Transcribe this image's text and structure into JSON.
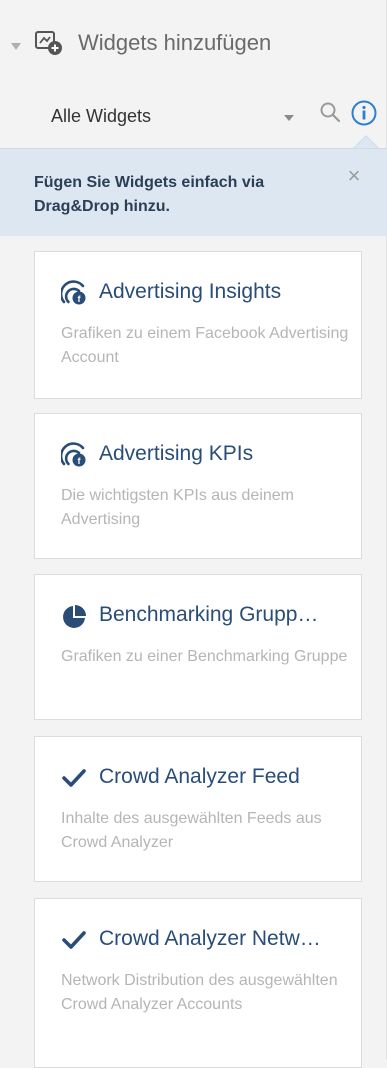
{
  "header": {
    "title": "Widgets hinzufügen",
    "icon": "add-widget-icon"
  },
  "filter": {
    "selected": "Alle Widgets",
    "search_icon": "search-icon",
    "info_icon": "info-icon"
  },
  "info_box": {
    "text": "Fügen Sie Widgets einfach via Drag&Drop hinzu.",
    "close_glyph": "×"
  },
  "widgets": [
    {
      "title": "Advertising Insights",
      "description": "Grafiken zu einem Facebook Advertising Account",
      "icon": "advertising-icon"
    },
    {
      "title": "Advertising KPIs",
      "description": "Die wichtigsten KPIs aus deinem Advertising",
      "icon": "advertising-icon"
    },
    {
      "title": "Benchmarking Grupp…",
      "description": "Grafiken zu einer Benchmarking Gruppe",
      "icon": "pie-chart-icon"
    },
    {
      "title": "Crowd Analyzer Feed",
      "description": "Inhalte des ausgewählten Feeds aus Crowd Analyzer",
      "icon": "checkmark-icon"
    },
    {
      "title": "Crowd Analyzer Netw…",
      "description": "Network Distribution des ausgewählten Crowd Analyzer Accounts",
      "icon": "checkmark-icon"
    }
  ],
  "colors": {
    "title": "#2a4d78",
    "info_bg": "#dde7f1",
    "link_blue": "#2f7fd0"
  }
}
